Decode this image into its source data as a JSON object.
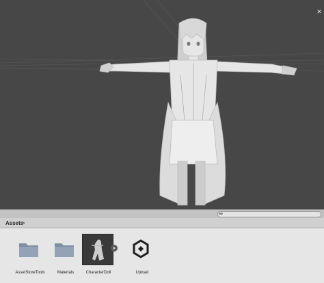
{
  "scene": {
    "background": "#474747",
    "model_color": "#e6e6e6",
    "corner_icon": "close-icon"
  },
  "assets_panel": {
    "breadcrumb_root": "Assets",
    "breadcrumb_sep": ">",
    "items": [
      {
        "label": "AssetStoreTools",
        "icon": "folder-icon"
      },
      {
        "label": "Materials",
        "icon": "folder-icon"
      },
      {
        "label": "CharacterDoll",
        "icon": "model-thumbnail-icon",
        "selected": true
      },
      {
        "label": "Upload",
        "icon": "unity-logo-icon"
      }
    ]
  }
}
